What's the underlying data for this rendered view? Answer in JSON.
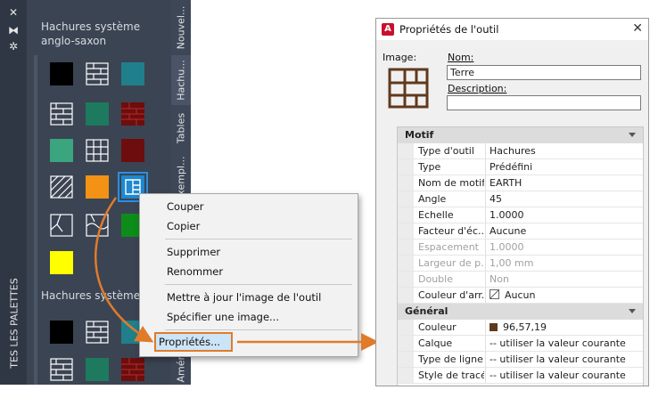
{
  "palette": {
    "strip_label": "TES LES PALETTES",
    "strip_icons": [
      "close-icon",
      "auto-hide-icon",
      "settings-icon"
    ],
    "section1_title": "Hachures système anglo-saxon",
    "section2_title": "Hachures système IS",
    "tabs": [
      "Nouvel...",
      "Hachu...",
      "Tables",
      "Exempl...",
      "Amér..."
    ],
    "swatch_colors": {
      "black": "#000000",
      "teal": "#1f7f8a",
      "green": "#1d7a5e",
      "seafoam": "#3aa57f",
      "darkred": "#6d0d0d",
      "orange": "#f39215",
      "lime": "#0d8c1a",
      "yellow": "#ffff00",
      "selected": "#1e88d0"
    }
  },
  "context_menu": {
    "items": [
      "Couper",
      "Copier",
      "Supprimer",
      "Renommer",
      "Mettre à jour l'image de l'outil",
      "Spécifier une image...",
      "Propriétés..."
    ]
  },
  "dialog": {
    "title": "Propriétés de l'outil",
    "image_label": "Image:",
    "name_label": "Nom:",
    "name_value": "Terre",
    "description_label": "Description:",
    "description_value": "",
    "categories": [
      {
        "label": "Motif",
        "rows": [
          {
            "key": "Type d'outil",
            "value": "Hachures"
          },
          {
            "key": "Type",
            "value": "Prédéfini"
          },
          {
            "key": "Nom de motif",
            "value": "EARTH"
          },
          {
            "key": "Angle",
            "value": "45"
          },
          {
            "key": "Echelle",
            "value": "1.0000"
          },
          {
            "key": "Facteur d'éc...",
            "value": "Aucune"
          },
          {
            "key": "Espacement",
            "value": "1.0000"
          },
          {
            "key": "Largeur de p...",
            "value": "1,00 mm"
          },
          {
            "key": "Double",
            "value": "Non"
          },
          {
            "key": "Couleur d'arr...",
            "value": "Aucun"
          }
        ]
      },
      {
        "label": "Général",
        "rows": [
          {
            "key": "Couleur",
            "value": "96,57,19"
          },
          {
            "key": "Calque",
            "value": "-- utiliser la valeur courante"
          },
          {
            "key": "Type de ligne",
            "value": "-- utiliser la valeur courante"
          },
          {
            "key": "Style de tracé",
            "value": "-- utiliser la valeur courante"
          }
        ]
      }
    ],
    "color_value_hex": "#60391",
    "accent": "#e07b2a"
  }
}
